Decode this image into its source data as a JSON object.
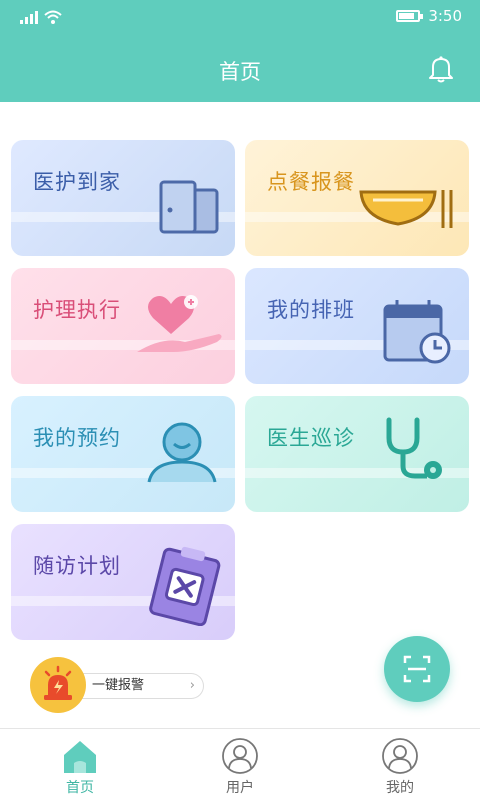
{
  "status_bar": {
    "time": "3:50",
    "battery_level": 0.85
  },
  "header": {
    "title": "首页"
  },
  "cards": [
    {
      "label": "医护到家",
      "icon": "door-icon"
    },
    {
      "label": "点餐报餐",
      "icon": "bowl-icon"
    },
    {
      "label": "护理执行",
      "icon": "heart-hand-icon"
    },
    {
      "label": "我的排班",
      "icon": "calendar-clock-icon"
    },
    {
      "label": "我的预约",
      "icon": "person-icon"
    },
    {
      "label": "医生巡诊",
      "icon": "stethoscope-icon"
    },
    {
      "label": "随访计划",
      "icon": "clipboard-icon"
    }
  ],
  "alarm": {
    "label": "一键报警",
    "icon": "siren-icon"
  },
  "scan": {
    "icon": "scan-icon"
  },
  "tabs": [
    {
      "label": "首页",
      "icon": "home-icon",
      "active": true
    },
    {
      "label": "用户",
      "icon": "user-icon",
      "active": false
    },
    {
      "label": "我的",
      "icon": "profile-icon",
      "active": false
    }
  ],
  "colors": {
    "primary": "#5fcdbd",
    "active_tab": "#3fb6a4",
    "alarm": "#f6c23e"
  }
}
